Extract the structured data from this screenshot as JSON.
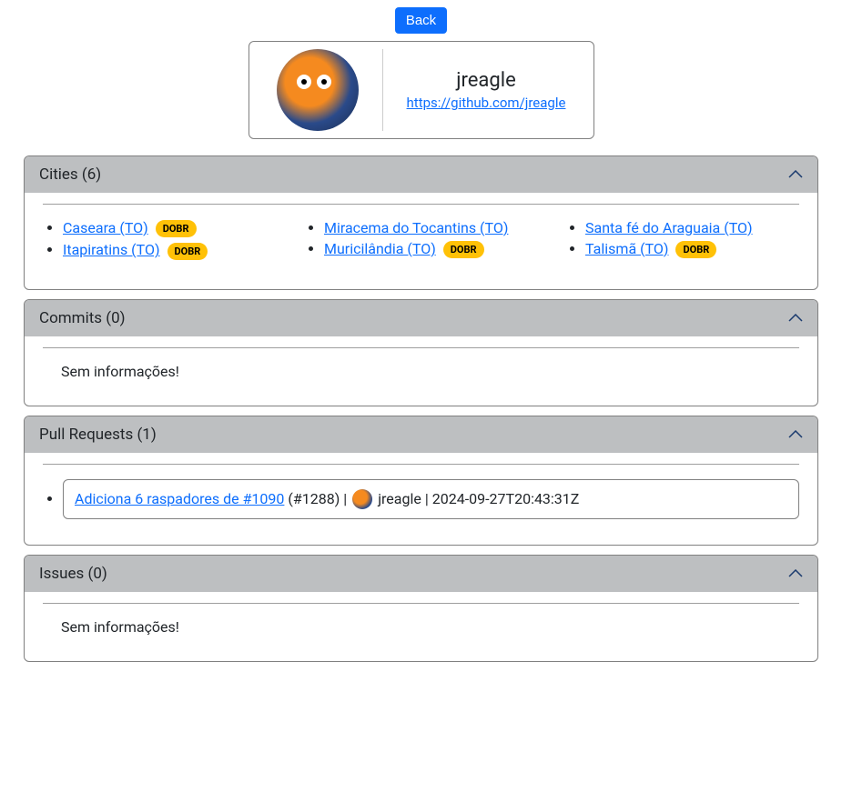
{
  "back_label": "Back",
  "profile": {
    "name": "jreagle",
    "url": "https://github.com/jreagle"
  },
  "panels": {
    "cities": {
      "title": "Cities (6)",
      "badge_text": "DOBR",
      "columns": [
        [
          {
            "label": "Caseara (TO)",
            "badge": true
          },
          {
            "label": "Itapiratins (TO)",
            "badge": true
          }
        ],
        [
          {
            "label": "Miracema do Tocantins (TO)",
            "badge": false
          },
          {
            "label": "Muricilândia (TO)",
            "badge": true
          }
        ],
        [
          {
            "label": "Santa fé do Araguaia (TO)",
            "badge": false
          },
          {
            "label": "Talismã (TO)",
            "badge": true
          }
        ]
      ]
    },
    "commits": {
      "title": "Commits (0)",
      "empty": "Sem informações!"
    },
    "pulls": {
      "title": "Pull Requests (1)",
      "items": [
        {
          "link_text": "Adiciona 6 raspadores de #1090",
          "number": "(#1288)",
          "sep1": " | ",
          "author": "jreagle",
          "sep2": " | ",
          "date": "2024-09-27T20:43:31Z"
        }
      ]
    },
    "issues": {
      "title": "Issues (0)",
      "empty": "Sem informações!"
    }
  }
}
